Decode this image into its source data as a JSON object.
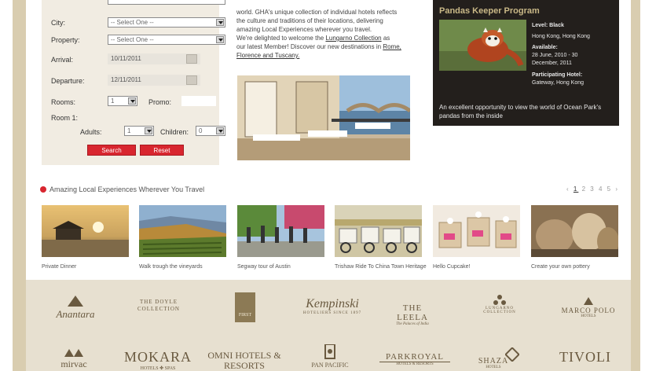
{
  "booking": {
    "city_label": "City:",
    "city_value": "-- Select One --",
    "property_label": "Property:",
    "property_value": "-- Select One --",
    "arrival_label": "Arrival:",
    "arrival_value": "10/11/2011",
    "departure_label": "Departure:",
    "departure_value": "12/11/2011",
    "rooms_label": "Rooms:",
    "rooms_value": "1",
    "promo_label": "Promo:",
    "room1_label": "Room 1:",
    "adults_label": "Adults:",
    "adults_value": "1",
    "children_label": "Children:",
    "children_value": "0",
    "search_label": "Search",
    "reset_label": "Reset"
  },
  "intro": {
    "line1": "world. GHA's unique collection of individual hotels reflects",
    "line2": "the culture and traditions of their locations, delivering",
    "line3": "amazing Local Experiences wherever you travel.",
    "line4_pre": "We're delighted to welcome the ",
    "line4_link": "Lungarno Collection",
    "line4_post": " as",
    "line5_pre": "our latest Member! Discover our new destinations in ",
    "line5_link": "Rome,",
    "line6_link": "Florence and Tuscany."
  },
  "pandas": {
    "title": "Pandas Keeper Program",
    "level": "Level: Black",
    "location": "Hong Kong, Hong Kong",
    "available_label": "Available:",
    "available_1": "28 June, 2010 - 30",
    "available_2": "December, 2011",
    "hotel_label": "Participating Hotel:",
    "hotel_value": "Gateway, Hong Kong",
    "desc": "An excellent opportunity to view the world of Ocean Park's pandas from the inside"
  },
  "experiences": {
    "heading": "Amazing Local Experiences Wherever You Travel",
    "pager_prev": "‹",
    "pager_pages": [
      "1",
      "2",
      "3",
      "4",
      "5"
    ],
    "pager_next": "›",
    "items": [
      {
        "caption": "Private Dinner"
      },
      {
        "caption": "Walk trough the vineyards"
      },
      {
        "caption": "Segway tour of Austin"
      },
      {
        "caption": "Trishaw Ride To China Town Heritage"
      },
      {
        "caption": "Hello Cupcake!"
      },
      {
        "caption": "Create your own pottery"
      }
    ]
  },
  "brands": {
    "row1": [
      "Anantara",
      "THE DOYLE COLLECTION",
      "FIRST",
      "Kempinski",
      "THE LEELA",
      "LUNGARNO COLLECTION",
      "MARCO POLO"
    ],
    "row2": [
      "mirvac",
      "MOKARA",
      "OMNI HOTELS & RESORTS",
      "PAN PACIFIC",
      "PARKROYAL",
      "SHAZA",
      "TIVOLI"
    ],
    "sub": {
      "kempinski": "HOTELIERS SINCE 1897",
      "leela": "The Palaces of India",
      "marco": "HOTELS",
      "mokara": "HOTELS ✤ SPAS",
      "parkroyal": "HOTELS & RESORTS",
      "shaza": "HOTELS"
    }
  }
}
